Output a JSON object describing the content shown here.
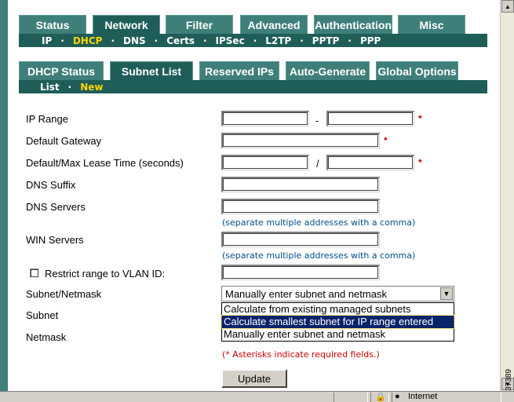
{
  "main_tabs": [
    "Status",
    "Network",
    "Filter",
    "Advanced",
    "Authentication",
    "Misc"
  ],
  "main_active": "Network",
  "network_subnav": [
    "IP",
    "DHCP",
    "DNS",
    "Certs",
    "IPSec",
    "L2TP",
    "PPTP",
    "PPP"
  ],
  "network_subnav_active": "DHCP",
  "dhcp_tabs": [
    "DHCP Status",
    "Subnet List",
    "Reserved IPs",
    "Auto-Generate",
    "Global Options"
  ],
  "dhcp_active": "Subnet List",
  "subnet_subnav": [
    "List",
    "New"
  ],
  "subnet_subnav_active": "New",
  "form": {
    "ip_range_label": "IP Range",
    "ip_range_separator": "-",
    "gateway_label": "Default Gateway",
    "lease_label": "Default/Max Lease Time (seconds)",
    "lease_separator": "/",
    "dns_suffix_label": "DNS Suffix",
    "dns_servers_label": "DNS Servers",
    "dns_servers_hint": "(separate multiple addresses with a comma)",
    "win_servers_label": "WIN Servers",
    "win_servers_hint": "(separate multiple addresses with a comma)",
    "restrict_vlan_label": "Restrict range to VLAN ID:",
    "restrict_vlan_checked": false,
    "subnet_netmask_label": "Subnet/Netmask",
    "subnet_netmask_value": "Manually enter subnet and netmask",
    "subnet_netmask_options": [
      "Calculate from existing managed subnets",
      "Calculate smallest subnet for IP range entered",
      "Manually enter subnet and netmask"
    ],
    "subnet_netmask_highlighted": "Calculate smallest subnet for IP range entered",
    "subnet_label": "Subnet",
    "netmask_label": "Netmask",
    "required_mark": "*",
    "required_note": "(* Asterisks indicate required fields.)",
    "update_button": "Update"
  },
  "statusbar": {
    "zone": "Internet"
  },
  "figure_number": "137389",
  "colors": {
    "tab": "#3f7f7a",
    "tab_active": "#1f5e58",
    "subnav_active": "#ffd400",
    "required": "#cc0000",
    "hint": "#004f8a"
  }
}
